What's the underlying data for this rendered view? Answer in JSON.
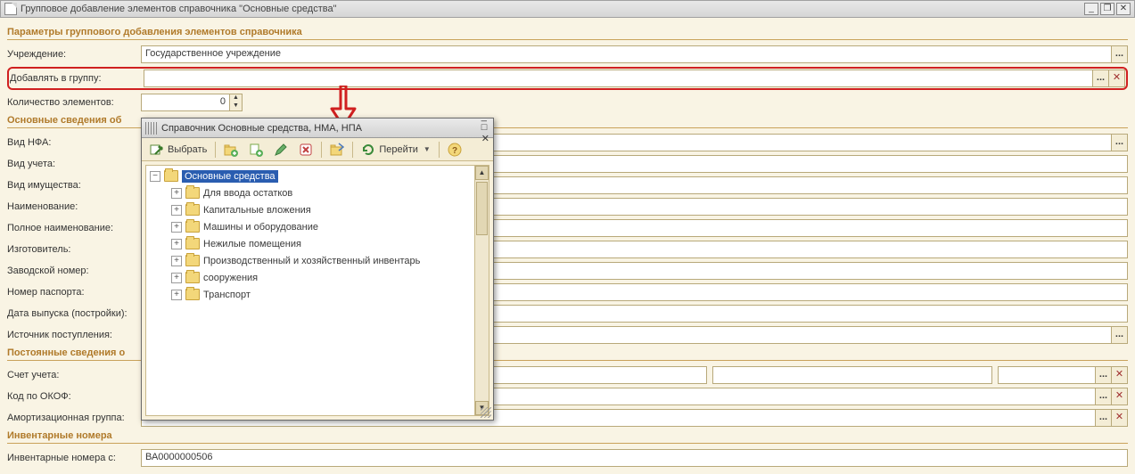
{
  "window": {
    "title": "Групповое добавление элементов справочника \"Основные средства\"",
    "btn_min": "_",
    "btn_restore": "❐",
    "btn_close": "✕"
  },
  "sections": {
    "params": "Параметры группового добавления элементов справочника",
    "basic": "Основные сведения об",
    "perm": "Постоянные сведения о",
    "inv": "Инвентарные номера"
  },
  "labels": {
    "org": "Учреждение:",
    "group": "Добавлять в группу:",
    "count": "Количество элементов:",
    "nfa_type": "Вид НФА:",
    "acct_type": "Вид учета:",
    "prop_type": "Вид имущества:",
    "name": "Наименование:",
    "full_name": "Полное наименование:",
    "maker": "Изготовитель:",
    "factory_no": "Заводской номер:",
    "passport_no": "Номер паспорта:",
    "release_date": "Дата выпуска (постройки):",
    "source": "Источник поступления:",
    "account": "Счет учета:",
    "okof": "Код по ОКОФ:",
    "amort_group": "Амортизационная группа:",
    "inv_from": "Инвентарные номера с:"
  },
  "values": {
    "org": "Государственное учреждение",
    "group": "",
    "count": "0",
    "nfa_type": "",
    "acct_type": "",
    "prop_type": "",
    "name": "",
    "full_name": "",
    "maker": "",
    "factory_no": "",
    "passport_no": "",
    "release_date": "",
    "source": "",
    "account": "",
    "account_a": "",
    "account_b": "",
    "account_c": "",
    "okof": "",
    "amort_group": "",
    "inv_from": "ВА0000000506"
  },
  "buttons": {
    "ellipsis": "...",
    "clear": "✕",
    "spin_up": "▲",
    "spin_down": "▼"
  },
  "popup": {
    "title": "Справочник Основные средства, НМА, НПА",
    "select_label": "Выбрать",
    "goto_label": "Перейти",
    "tree_root": "Основные средства",
    "children": [
      "Для ввода остатков",
      "Капитальные вложения",
      "Машины и оборудование",
      "Нежилые помещения",
      "Производственный и хозяйственный инвентарь",
      "сооружения",
      "Транспорт"
    ],
    "btn_min": "_",
    "btn_max": "□",
    "btn_close": "✕",
    "scroll_up": "▲",
    "scroll_down": "▼"
  }
}
